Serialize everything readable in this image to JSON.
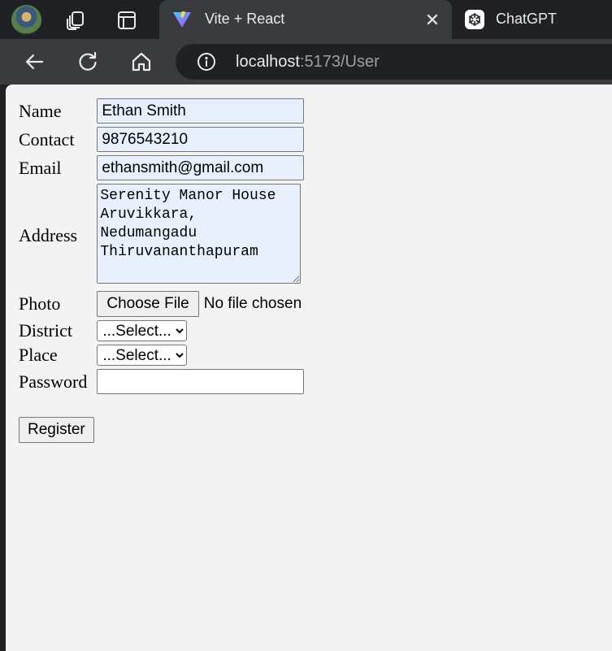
{
  "browser": {
    "active_tab": {
      "title": "Vite + React",
      "close_glyph": "✕"
    },
    "other_tab": {
      "title": "ChatGPT"
    },
    "url": {
      "host": "localhost",
      "rest": ":5173/User"
    },
    "icons": [
      "profile-avatar",
      "workspaces-icon",
      "tab-actions-icon",
      "vite-icon",
      "close-icon",
      "chatgpt-icon",
      "back-icon",
      "reload-icon",
      "home-icon",
      "info-icon"
    ]
  },
  "form": {
    "name": {
      "label": "Name",
      "value": "Ethan Smith"
    },
    "contact": {
      "label": "Contact",
      "value": "9876543210"
    },
    "email": {
      "label": "Email",
      "value": "ethansmith@gmail.com"
    },
    "address": {
      "label": "Address",
      "value": "Serenity Manor House\nAruvikkara,\nNedumangadu\nThiruvananthapuram"
    },
    "photo": {
      "label": "Photo",
      "button": "Choose File",
      "status": "No file chosen"
    },
    "district": {
      "label": "District",
      "selected": "...Select..."
    },
    "place": {
      "label": "Place",
      "selected": "...Select..."
    },
    "password": {
      "label": "Password",
      "value": ""
    },
    "register": "Register"
  },
  "colors": {
    "autofill_bg": "#e8f0fe",
    "page_bg": "#f3f3f3",
    "chrome_dark": "#202124",
    "chrome_toolbar": "#3a3b3e"
  }
}
